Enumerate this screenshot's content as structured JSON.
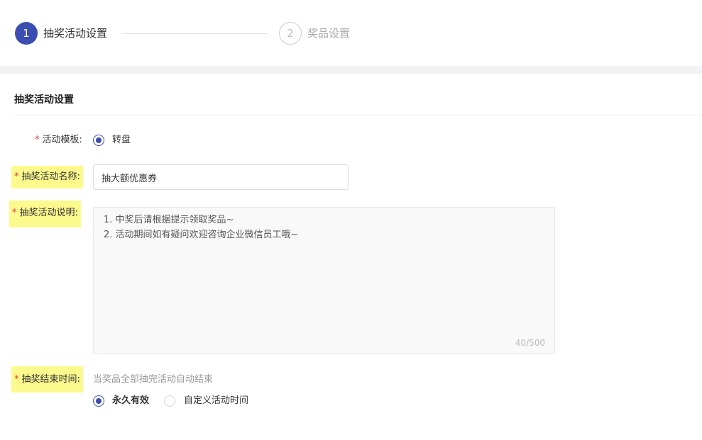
{
  "steps": [
    {
      "number": "1",
      "label": "抽奖活动设置",
      "active": true
    },
    {
      "number": "2",
      "label": "奖品设置",
      "active": false
    }
  ],
  "section": {
    "title": "抽奖活动设置"
  },
  "form": {
    "required_mark": "*",
    "template": {
      "label": "活动模板:",
      "options": [
        {
          "label": "转盘",
          "checked": true
        }
      ]
    },
    "name": {
      "label": "抽奖活动名称:",
      "value": "抽大额优惠券"
    },
    "description": {
      "label": "抽奖活动说明:",
      "lines": [
        "1. 中奖后请根据提示领取奖品~",
        "2. 活动期间如有疑问欢迎咨询企业微信员工哦~"
      ],
      "counter": "40/500"
    },
    "end_time": {
      "label": "抽奖结束时间:",
      "hint": "当奖品全部抽完活动自动结束",
      "options": [
        {
          "label": "永久有效",
          "checked": true
        },
        {
          "label": "自定义活动时间",
          "checked": false
        }
      ]
    }
  },
  "colors": {
    "primary": "#3b4db0",
    "required": "#e4393c",
    "highlight": "#fdfa8d"
  }
}
